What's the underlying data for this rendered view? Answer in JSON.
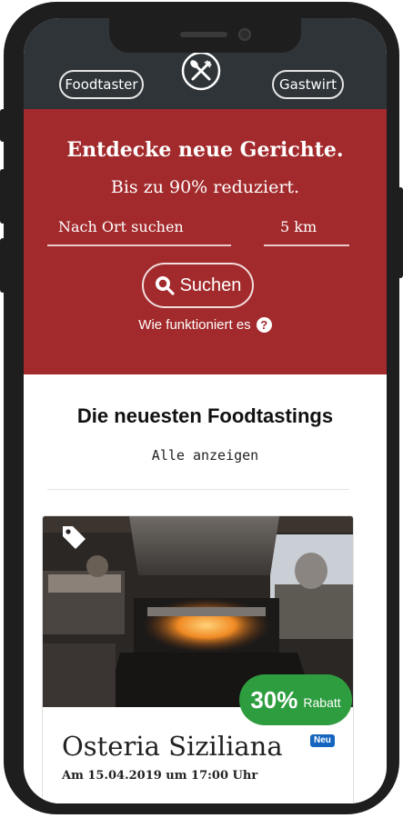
{
  "nav": {
    "left_button": "Foodtaster",
    "right_button": "Gastwirt",
    "logo_icon": "fork-knife-icon"
  },
  "hero": {
    "title": "Entdecke neue Gerichte.",
    "subtitle": "Bis zu 90% reduziert.",
    "location_placeholder": "Nach Ort suchen",
    "radius_value": "5 km",
    "search_button": "Suchen",
    "search_icon": "search-icon",
    "how_it_works": "Wie funktioniert es",
    "help_icon": "question-circle-icon",
    "background": "#a22a2c"
  },
  "latest": {
    "title": "Die neuesten Foodtastings",
    "show_all": "Alle anzeigen"
  },
  "card": {
    "tag_icon": "tag-icon",
    "discount_percent": "30%",
    "discount_label": "Rabatt",
    "discount_color": "#2e9d3f",
    "restaurant_name": "Osteria Siziliana",
    "badge": "Neu",
    "date": "Am 15.04.2019 um 17:00 Uhr"
  }
}
